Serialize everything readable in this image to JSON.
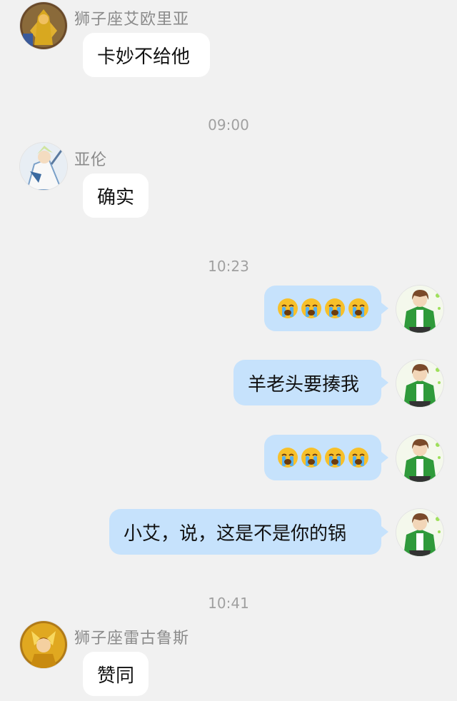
{
  "messages": [
    {
      "type": "left",
      "sender": "狮子座艾欧里亚",
      "text": "卡妙不给他",
      "avatar": "gold-saint-leo-avatar"
    },
    {
      "type": "time",
      "text": "09:00"
    },
    {
      "type": "left",
      "sender": "亚伦",
      "text": "确实",
      "avatar": "white-robe-character-avatar"
    },
    {
      "type": "time",
      "text": "10:23"
    },
    {
      "type": "right",
      "emoji": "😭😭😭😭",
      "avatar": "green-jacket-boy-avatar"
    },
    {
      "type": "right",
      "text": "羊老头要揍我",
      "avatar": "green-jacket-boy-avatar"
    },
    {
      "type": "right",
      "emoji": "😭😭😭😭",
      "avatar": "green-jacket-boy-avatar"
    },
    {
      "type": "right",
      "text": "小艾，说，这是不是你的锅",
      "avatar": "green-jacket-boy-avatar"
    },
    {
      "type": "time",
      "text": "10:41"
    },
    {
      "type": "left",
      "sender": "狮子座雷古鲁斯",
      "text": "赞同",
      "avatar": "gold-saint-regulus-avatar"
    }
  ],
  "colors": {
    "background": "#f1f1f1",
    "bubble_left": "#ffffff",
    "bubble_right": "#c6e2fc",
    "sender_name": "#8a8a8a",
    "timestamp": "#a0a0a0"
  }
}
